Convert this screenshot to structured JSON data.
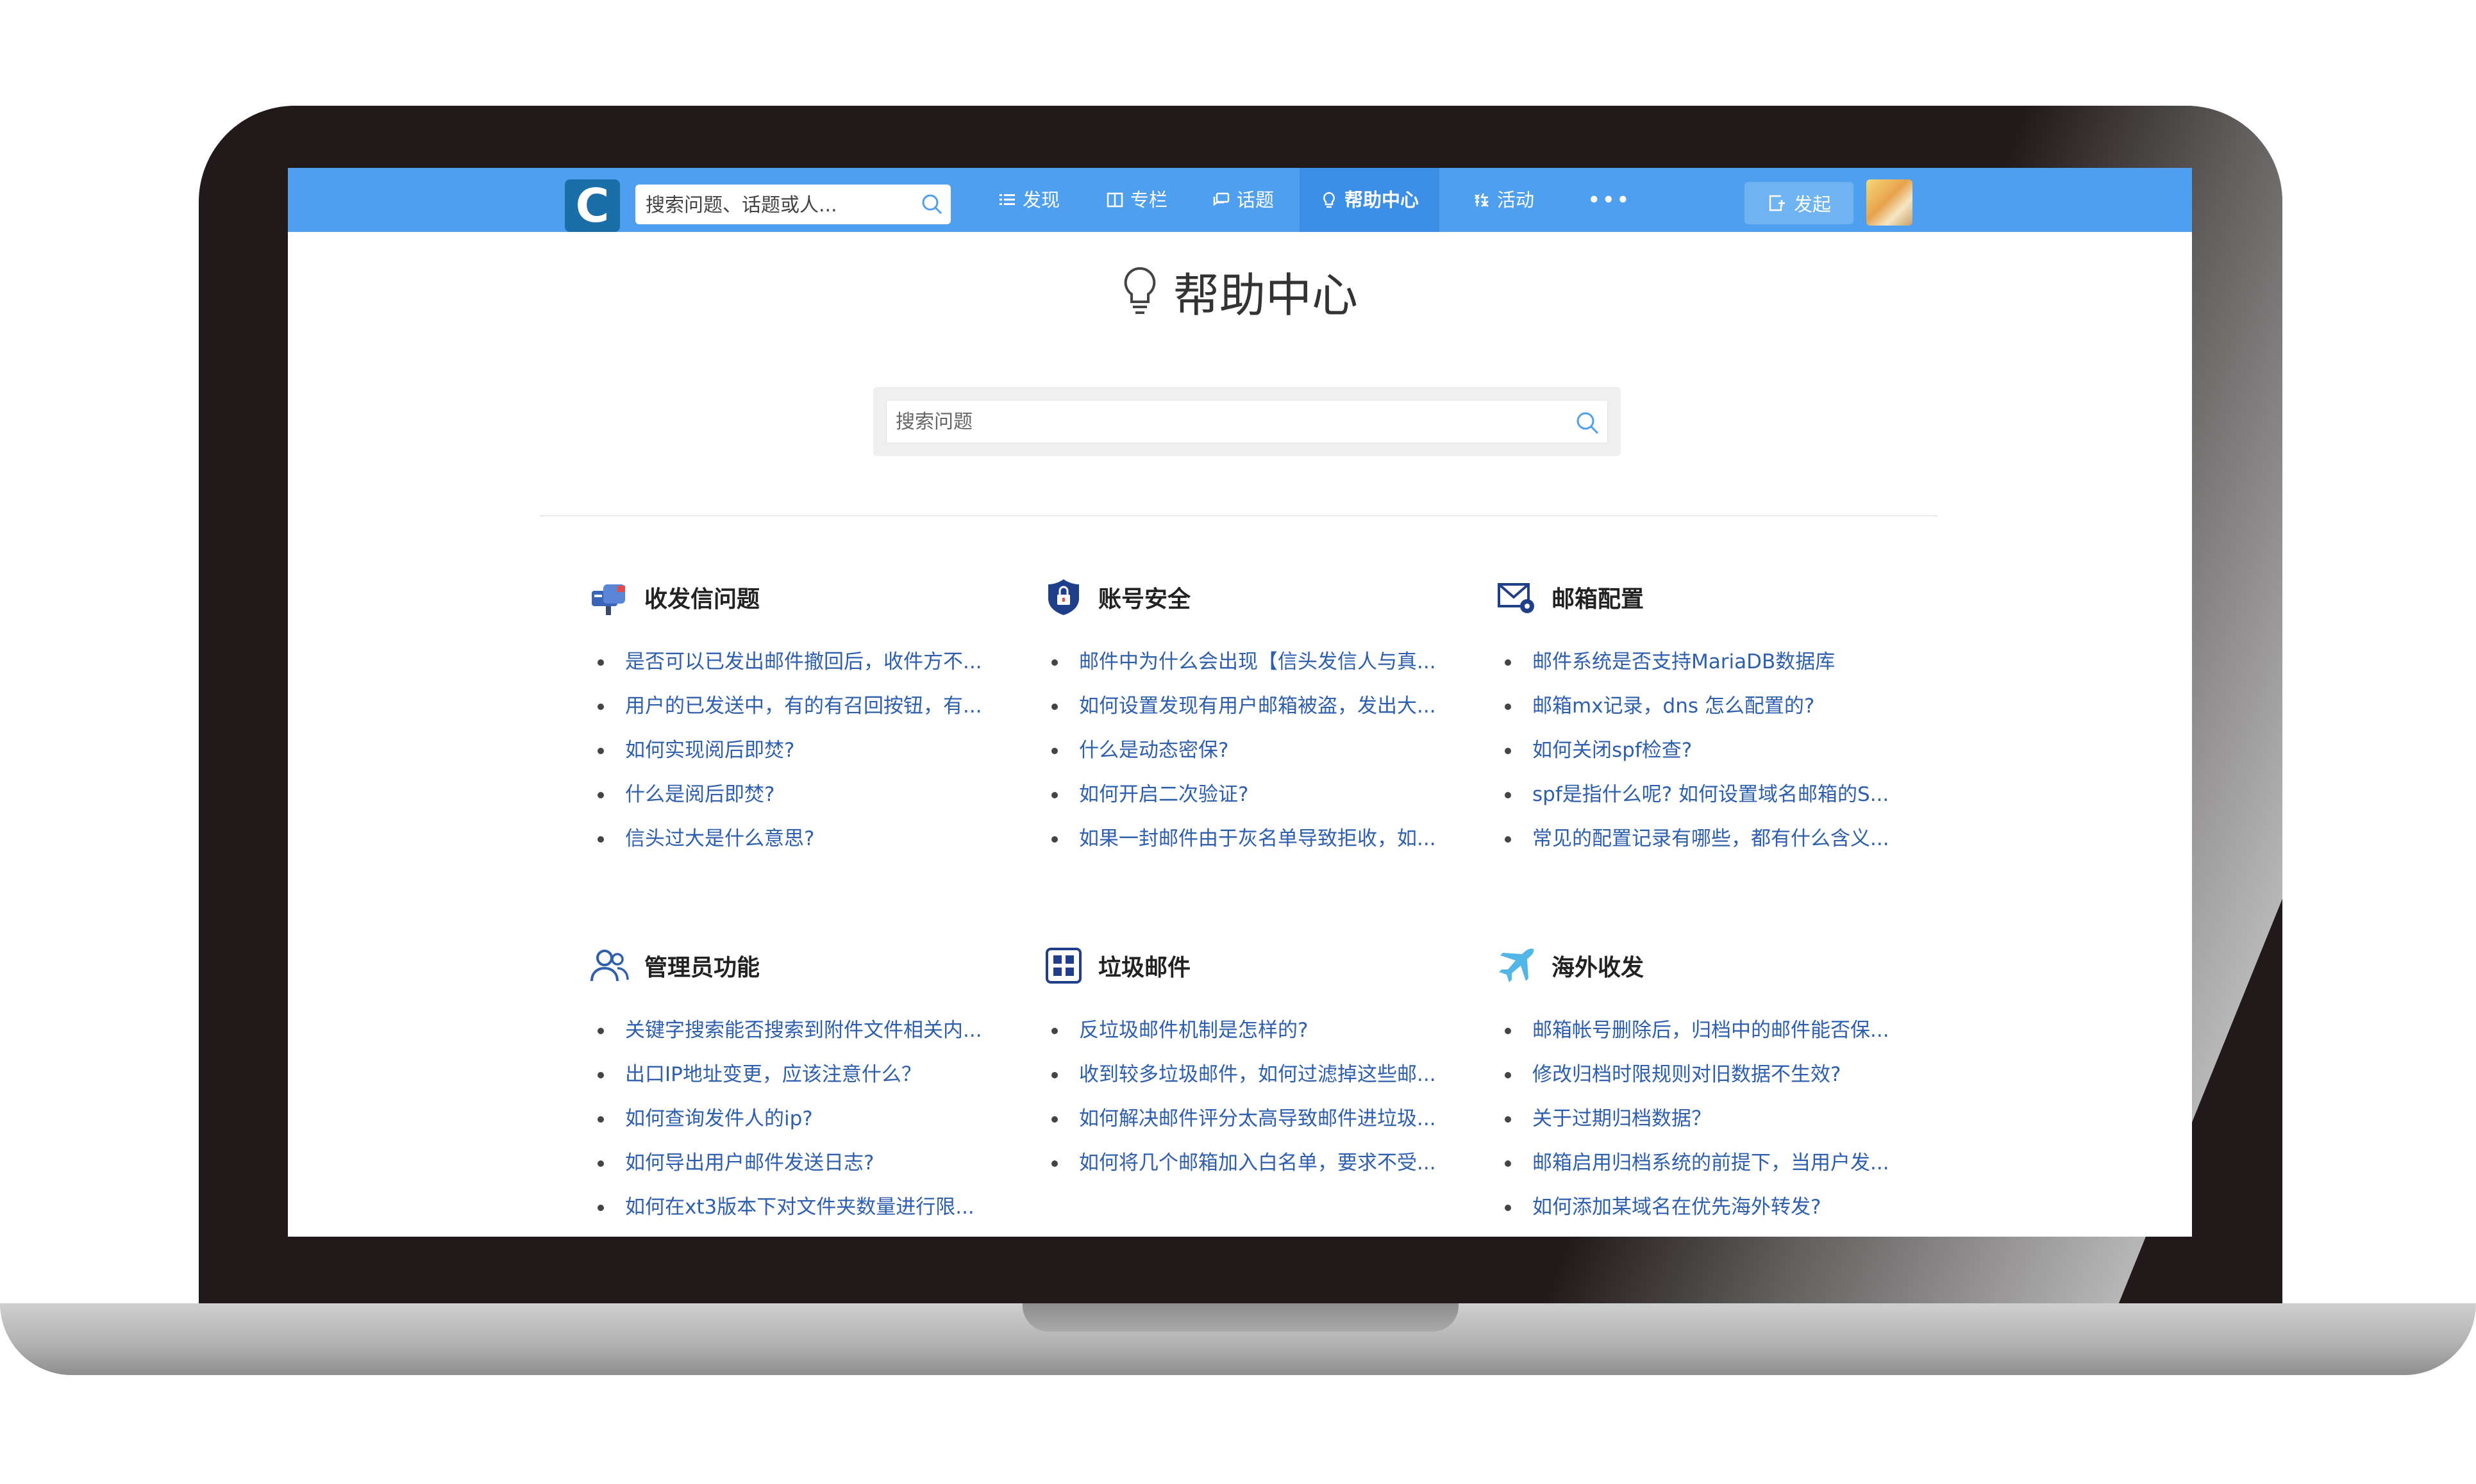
{
  "navbar": {
    "logo_letter": "C",
    "search_placeholder": "搜索问题、话题或人...",
    "items": [
      {
        "label": "发现",
        "icon": "list-icon"
      },
      {
        "label": "专栏",
        "icon": "columns-icon"
      },
      {
        "label": "话题",
        "icon": "topic-icon"
      },
      {
        "label": "帮助中心",
        "icon": "bulb-icon",
        "active": true
      },
      {
        "label": "活动",
        "icon": "activity-icon"
      }
    ],
    "more": "•••",
    "publish_label": "发起",
    "accent": "#4f9ff0"
  },
  "help": {
    "title": "帮助中心",
    "search_placeholder": "搜索问题"
  },
  "sections": [
    {
      "title": "收发信问题",
      "icon": "mailbox-icon",
      "items": [
        "是否可以已发出邮件撤回后，收件方不...",
        "用户的已发送中，有的有召回按钮，有...",
        "如何实现阅后即焚?",
        "什么是阅后即焚?",
        "信头过大是什么意思?"
      ]
    },
    {
      "title": "账号安全",
      "icon": "shield-icon",
      "items": [
        "邮件中为什么会出现【信头发信人与真...",
        "如何设置发现有用户邮箱被盗，发出大...",
        "什么是动态密保?",
        "如何开启二次验证?",
        "如果一封邮件由于灰名单导致拒收，如..."
      ]
    },
    {
      "title": "邮箱配置",
      "icon": "mail-settings-icon",
      "items": [
        "邮件系统是否支持MariaDB数据库",
        "邮箱mx记录，dns 怎么配置的?",
        "如何关闭spf检查?",
        "spf是指什么呢? 如何设置域名邮箱的S...",
        "常见的配置记录有哪些，都有什么含义..."
      ]
    },
    {
      "title": "管理员功能",
      "icon": "admin-users-icon",
      "items": [
        "关键字搜索能否搜索到附件文件相关内...",
        "出口IP地址变更，应该注意什么？",
        "如何查询发件人的ip?",
        "如何导出用户邮件发送日志?",
        "如何在xt3版本下对文件夹数量进行限..."
      ]
    },
    {
      "title": "垃圾邮件",
      "icon": "spam-grid-icon",
      "items": [
        "反垃圾邮件机制是怎样的?",
        "收到较多垃圾邮件，如何过滤掉这些邮...",
        "如何解决邮件评分太高导致邮件进垃圾...",
        "如何将几个邮箱加入白名单，要求不受..."
      ]
    },
    {
      "title": "海外收发",
      "icon": "plane-icon",
      "items": [
        "邮箱帐号删除后，归档中的邮件能否保...",
        "修改归档时限规则对旧数据不生效?",
        "关于过期归档数据？",
        "邮箱启用归档系统的前提下，当用户发...",
        "如何添加某域名在优先海外转发?"
      ]
    }
  ]
}
